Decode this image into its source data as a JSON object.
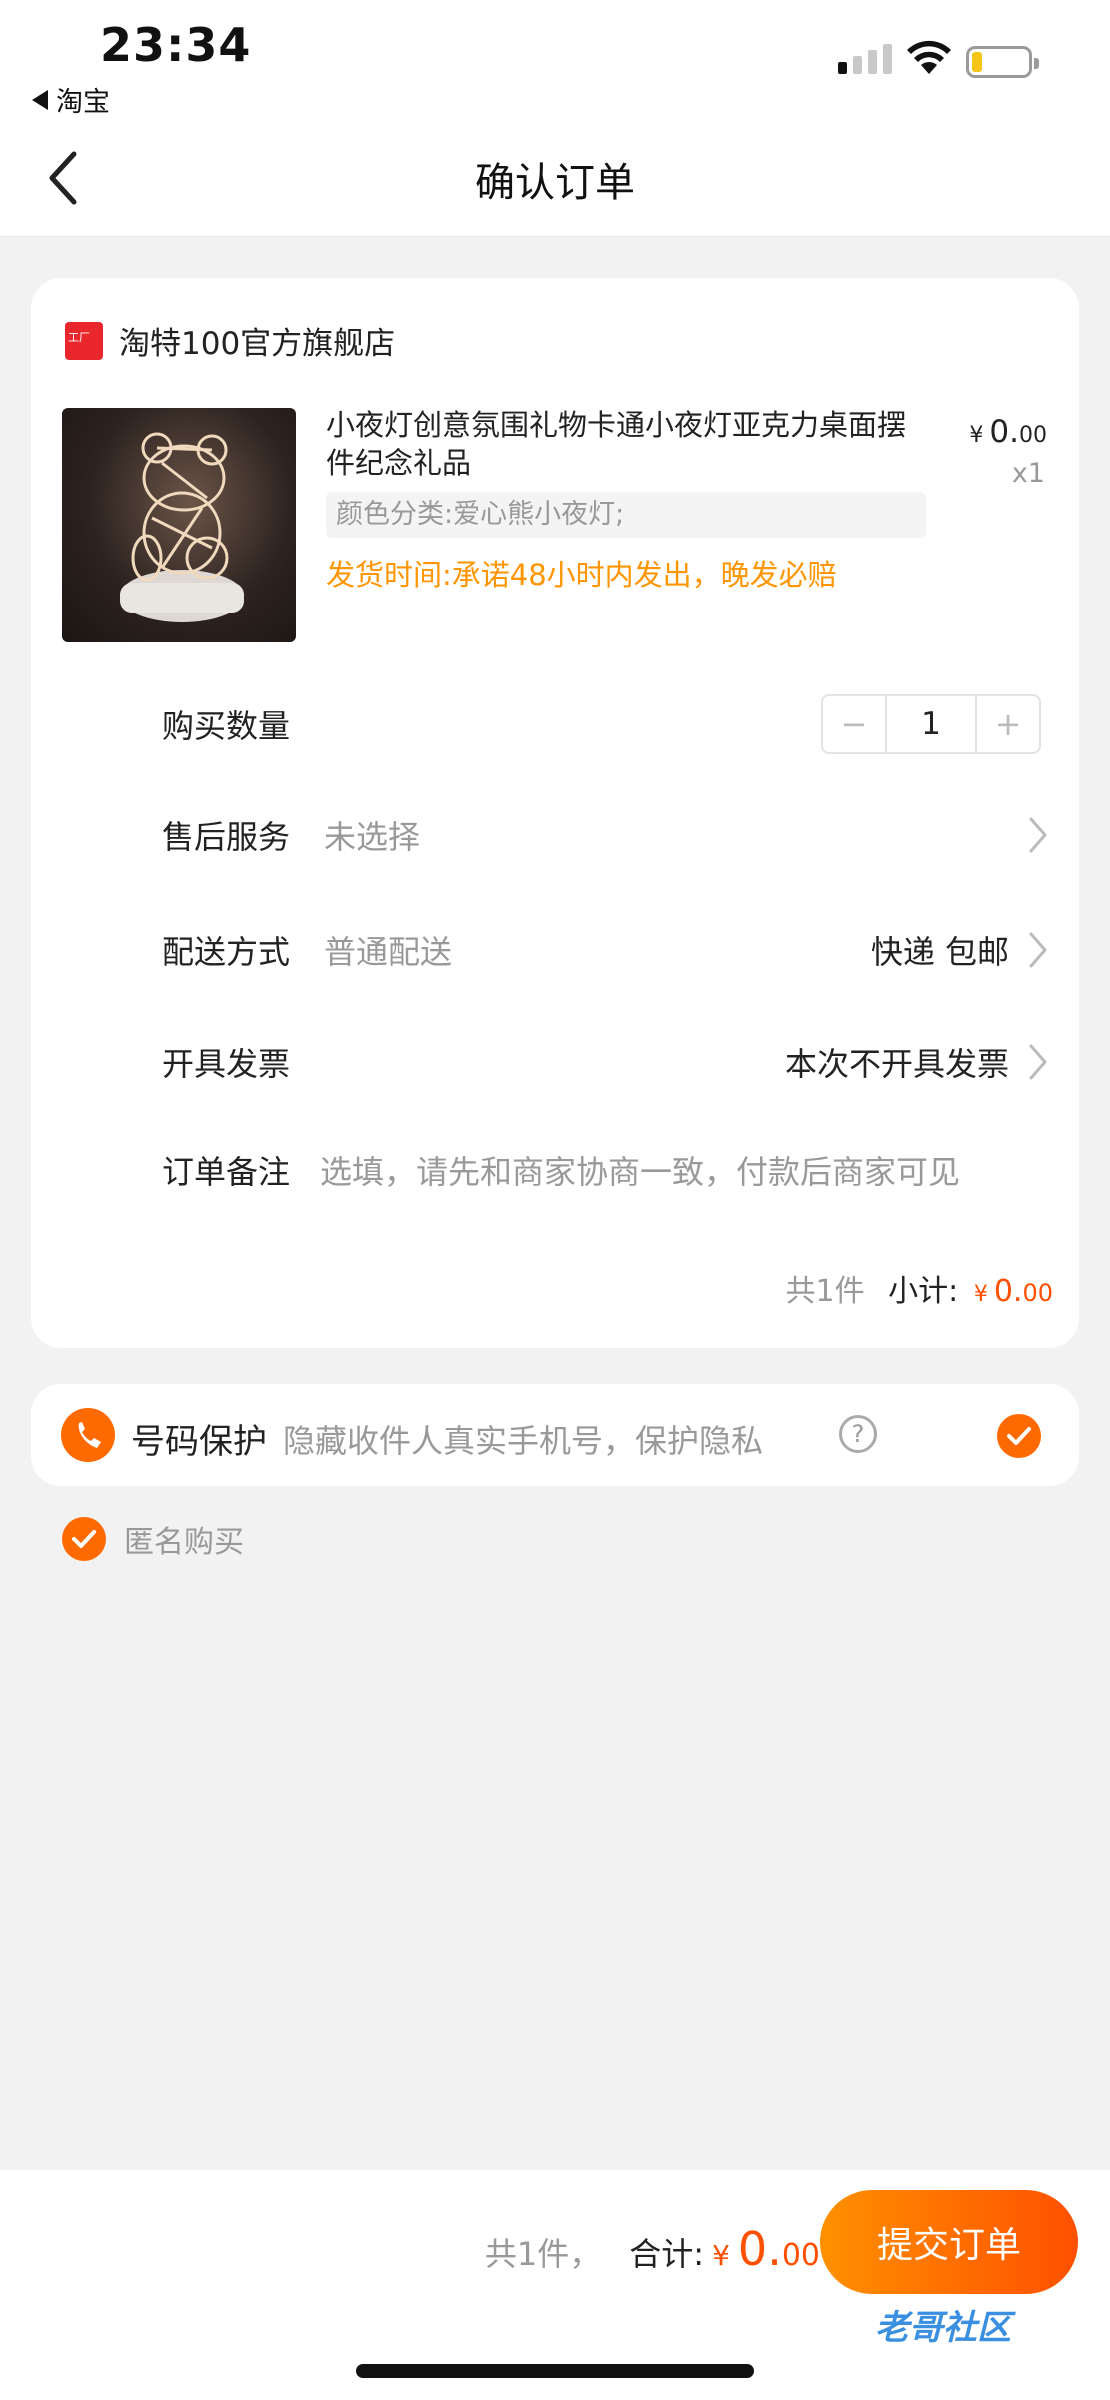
{
  "status_bar": {
    "time": "23:34",
    "back_app": "淘宝"
  },
  "nav": {
    "title": "确认订单"
  },
  "order": {
    "store_name": "淘特100官方旗舰店",
    "product_title": "小夜灯创意氛围礼物卡通小夜灯亚克力桌面摆件纪念礼品",
    "price_currency": "¥",
    "price_int": "0.",
    "price_dec": "00",
    "quantity_label": "x1",
    "spec": "颜色分类:爱心熊小夜灯;",
    "ship_note": "发货时间:承诺48小时内发出，晚发必赔",
    "rows": {
      "quantity": {
        "label": "购买数量",
        "value": "1",
        "minus": "−",
        "plus": "+"
      },
      "after_sales": {
        "label": "售后服务",
        "value": "未选择"
      },
      "delivery": {
        "label": "配送方式",
        "value": "普通配送",
        "right": "快递 包邮"
      },
      "invoice": {
        "label": "开具发票",
        "right": "本次不开具发票"
      },
      "note": {
        "label": "订单备注",
        "placeholder": "选填，请先和商家协商一致，付款后商家可见"
      }
    },
    "subtotal": {
      "count": "共1件",
      "label": "小计:",
      "currency": "¥",
      "int": "0.",
      "dec": "00"
    }
  },
  "privacy": {
    "label": "号码保护",
    "desc": "隐藏收件人真实手机号，保护隐私",
    "help": "?",
    "checked": true
  },
  "anonymous": {
    "label": "匿名购买",
    "checked": true
  },
  "footer": {
    "count": "共1件，",
    "total_label": "合计:",
    "currency": "¥",
    "int": "0.",
    "dec": "00",
    "submit": "提交订单",
    "watermark": "老哥社区"
  },
  "colors": {
    "accent": "#ff5000",
    "ship_note": "#ff9500",
    "store_icon": "#e8262b"
  }
}
